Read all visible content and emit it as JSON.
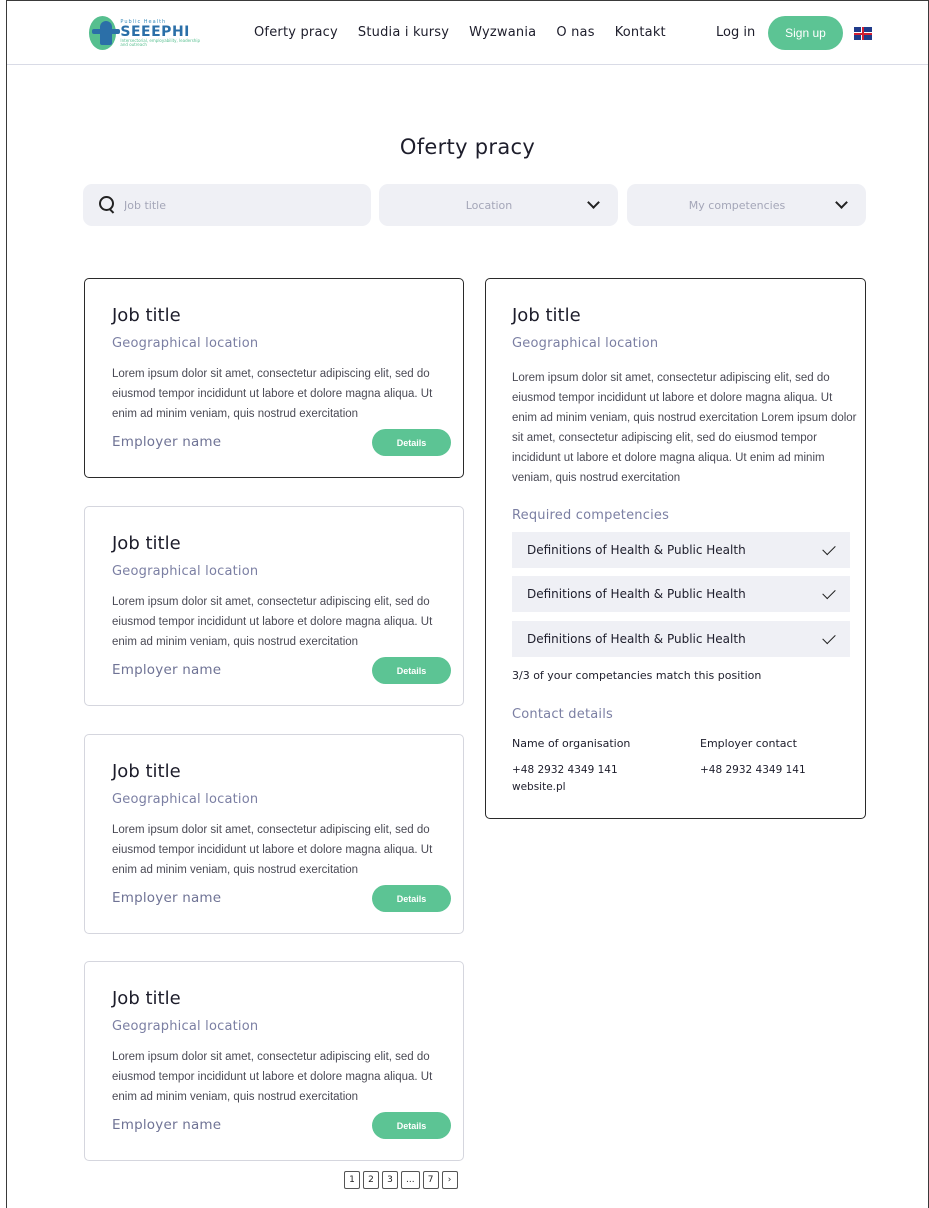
{
  "header": {
    "logo": {
      "small": "Public Health",
      "big": "SEEEPHI",
      "tagline": "Intersectorial, employability, leadership and outreach"
    },
    "nav": [
      "Oferty pracy",
      "Studia i kursy",
      "Wyzwania",
      "O nas",
      "Kontakt"
    ],
    "login": "Log in",
    "signup": "Sign up",
    "language_flag": "uk-flag-icon"
  },
  "page_title": "Oferty pracy",
  "filters": {
    "search_placeholder": "Job title",
    "location": "Location",
    "competencies": "My competencies"
  },
  "jobs": [
    {
      "title": "Job title",
      "location": "Geographical location",
      "description": "Lorem ipsum dolor sit amet, consectetur adipiscing elit, sed do eiusmod tempor incididunt ut labore et dolore magna aliqua. Ut enim ad minim veniam, quis nostrud exercitation",
      "employer": "Employer name",
      "button": "Details"
    },
    {
      "title": "Job title",
      "location": "Geographical location",
      "description": "Lorem ipsum dolor sit amet, consectetur adipiscing elit, sed do eiusmod tempor incididunt ut labore et dolore magna aliqua. Ut enim ad minim veniam, quis nostrud exercitation",
      "employer": "Employer name",
      "button": "Details"
    },
    {
      "title": "Job title",
      "location": "Geographical location",
      "description": "Lorem ipsum dolor sit amet, consectetur adipiscing elit, sed do eiusmod tempor incididunt ut labore et dolore magna aliqua. Ut enim ad minim veniam, quis nostrud exercitation",
      "employer": "Employer name",
      "button": "Details"
    },
    {
      "title": "Job title",
      "location": "Geographical location",
      "description": "Lorem ipsum dolor sit amet, consectetur adipiscing elit, sed do eiusmod tempor incididunt ut labore et dolore magna aliqua. Ut enim ad minim veniam, quis nostrud exercitation",
      "employer": "Employer name",
      "button": "Details"
    }
  ],
  "detail": {
    "title": "Job title",
    "location": "Geographical location",
    "description": "Lorem ipsum dolor sit amet, consectetur adipiscing elit, sed do eiusmod tempor incididunt ut labore et dolore magna aliqua. Ut enim ad minim veniam, quis nostrud exercitation Lorem ipsum dolor sit amet, consectetur adipiscing elit, sed do eiusmod tempor incididunt ut labore et dolore magna aliqua. Ut enim ad minim veniam, quis nostrud exercitation",
    "competencies_heading": "Required competencies",
    "competencies": [
      "Definitions of Health & Public Health",
      "Definitions of Health & Public Health",
      "Definitions of Health & Public Health"
    ],
    "match_text": "3/3 of your competancies match this position",
    "contact_heading": "Contact details",
    "org_label": "Name of organisation",
    "org_phone": "+48 2932 4349 141",
    "org_website": "website.pl",
    "employer_label": "Employer contact",
    "employer_phone": "+48 2932 4349 141"
  },
  "pagination": [
    "1",
    "2",
    "3",
    "...",
    "7",
    "›"
  ],
  "colors": {
    "accent": "#5cc494",
    "filter_bg": "#eff0f5",
    "muted": "#7b7fa3"
  }
}
